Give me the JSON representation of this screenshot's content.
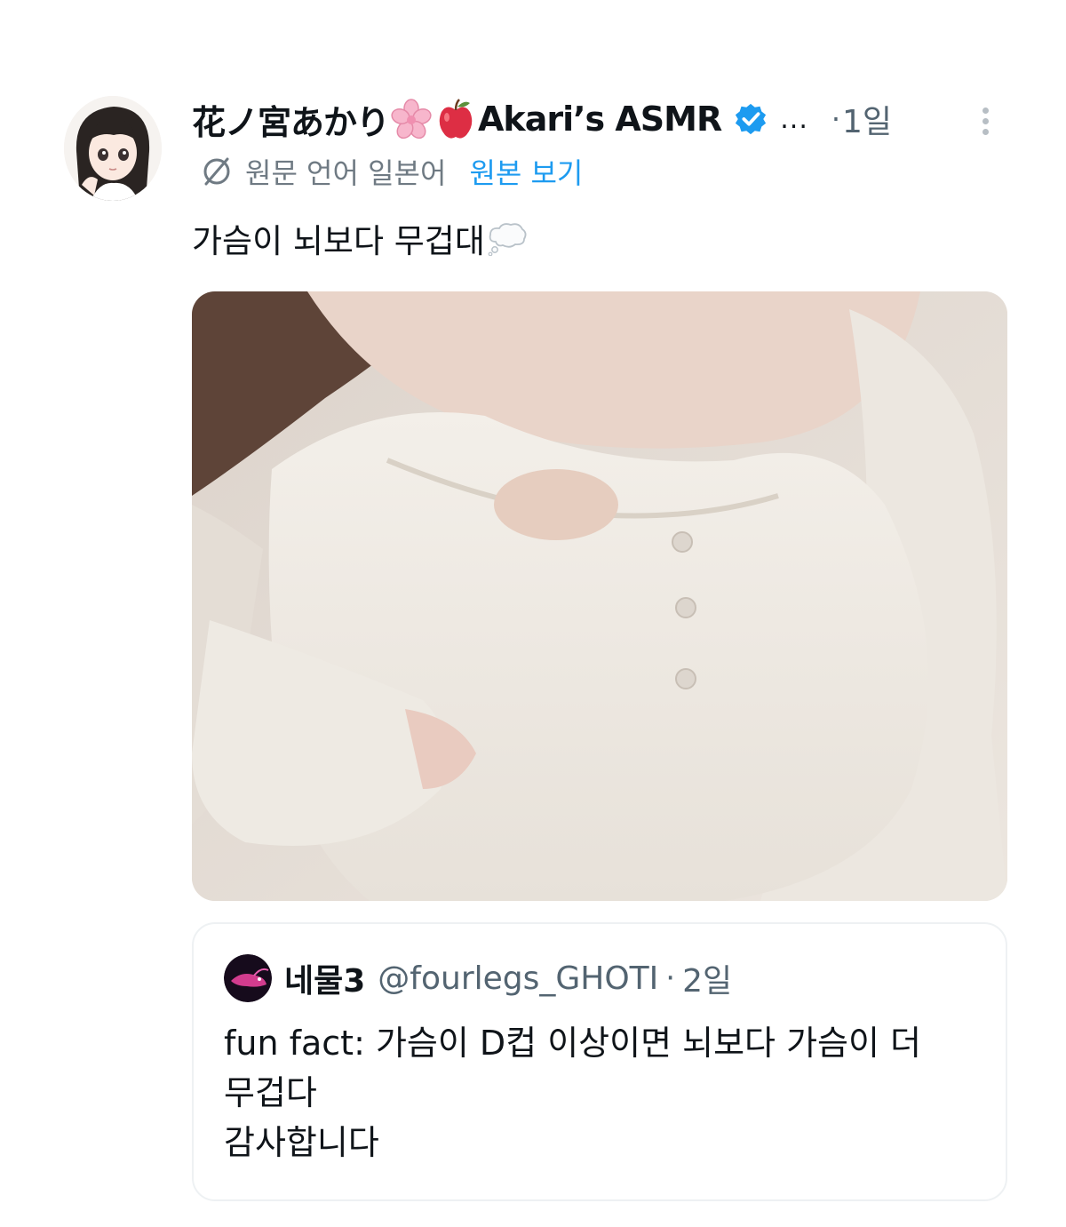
{
  "post": {
    "display_name": "花ノ宮あかり",
    "display_name_suffix": "Akari’s ASMR",
    "emoji_1": "cherry-blossom",
    "emoji_2": "apple",
    "verified_icon": "verified-badge-icon",
    "truncation": "...",
    "separator": "·",
    "time": "1일",
    "translation_note": "원문 언어 일본어",
    "view_original": "원본 보기",
    "text": "가슴이 뇌보다 무겁대",
    "text_emoji": "thought-balloon",
    "colors": {
      "link": "#1d9bf0",
      "secondary": "#536471",
      "verified": "#1d9bf0"
    }
  },
  "quote": {
    "name": "네물3",
    "handle": "@fourlegs_GHOTI",
    "separator": "·",
    "time": "2일",
    "lines": [
      "fun fact: 가슴이 D컵 이상이면 뇌보다 가슴이 더",
      "무겁다",
      "감사합니다"
    ]
  }
}
